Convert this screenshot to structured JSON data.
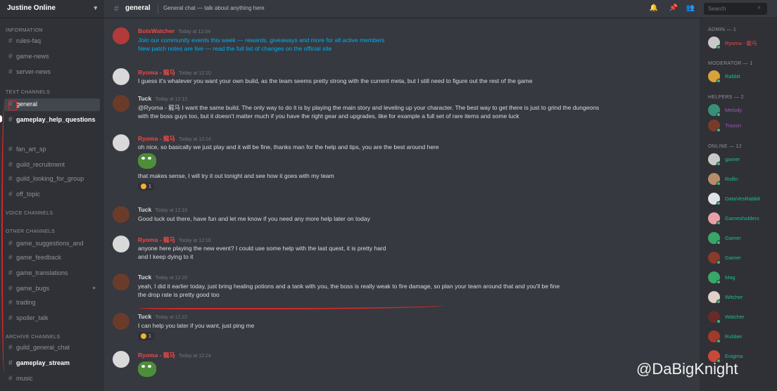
{
  "server": {
    "name": "Justine Online",
    "dropdown_icon": "chevron-down-icon"
  },
  "sidebar": {
    "categories": [
      "Information",
      "Text channels",
      "Voice channels",
      "Other channels",
      "Archive channels"
    ],
    "channels": [
      {
        "name": "rules-faq"
      },
      {
        "name": "game-news"
      },
      {
        "name": "server-news"
      },
      {
        "name": "general",
        "active": true
      },
      {
        "name": "gameplay_help_questions",
        "unread": true
      },
      {
        "name": "fan_art_sp"
      },
      {
        "name": "guild_recruitment"
      },
      {
        "name": "guild_looking_for_group"
      },
      {
        "name": "off_topic"
      },
      {
        "name": "game_suggestions_and"
      },
      {
        "name": "game_feedback"
      },
      {
        "name": "game_translations"
      },
      {
        "name": "game_bugs"
      },
      {
        "name": "trading"
      },
      {
        "name": "spoiler_talk"
      },
      {
        "name": "guild_general_chat"
      },
      {
        "name": "gameplay_stream",
        "unread": true
      },
      {
        "name": "music"
      }
    ],
    "add_label": "+"
  },
  "topbar": {
    "channel": "general",
    "topic": "General chat — talk about anything here",
    "search_placeholder": "Search",
    "icons": [
      "bell-icon",
      "pin-icon",
      "members-icon"
    ]
  },
  "chat": {
    "messages": [
      {
        "author": "BotsWatcher",
        "author_color": "#f04747",
        "timestamp": "Today at 12:04",
        "lines": [
          "Join our community events this week — rewards, giveaways and more for all active members",
          "New patch notes are live — read the full list of changes on the official site"
        ],
        "link": true
      },
      {
        "author": "Ryoma - 龍马",
        "author_color": "#f04747",
        "timestamp": "Today at 12:10",
        "lines": [
          "I guess it's whatever you want your own build, as the team seems pretty strong with the current meta, but I still need to figure out the rest of the game"
        ]
      },
      {
        "author": "Tuck",
        "author_color": "#dcddde",
        "timestamp": "Today at 12:12",
        "lines": [
          "@Ryoma - 龍马 I want the same build. The only way to do it is by playing the main story and leveling up your character. The best way to get there is just to grind the dungeons",
          "with the boss guys too, but it doesn't matter much if you have the right gear and upgrades, like for example a full set of rare items and some luck"
        ]
      },
      {
        "author": "Ryoma - 龍马",
        "author_color": "#f04747",
        "timestamp": "Today at 12:14",
        "lines": [
          "oh nice, so basically we just play and it will be fine, thanks man for the help and tips, you are the best around here"
        ],
        "sticker": true,
        "lines_after": [
          "that makes sense, I will try it out tonight and see how it goes with my team"
        ],
        "reaction": "1"
      },
      {
        "author": "Tuck",
        "author_color": "#dcddde",
        "timestamp": "Today at 12:16",
        "lines": [
          "Good luck out there, have fun and let me know if you need any more help later on today"
        ]
      },
      {
        "author": "Ryoma - 龍马",
        "author_color": "#f04747",
        "timestamp": "Today at 12:18",
        "lines": [
          "anyone here playing the new event? I could use some help with the last quest, it is pretty hard",
          "and I keep dying to it"
        ]
      },
      {
        "author": "Tuck",
        "author_color": "#dcddde",
        "timestamp": "Today at 12:20",
        "lines": [
          "yeah, I did it earlier today, just bring healing potions and a tank with you, the boss is really weak to fire damage, so plan your team around that and you'll be fine",
          "the drop rate is pretty good too"
        ]
      },
      {
        "author": "Tuck",
        "author_color": "#dcddde",
        "timestamp": "Today at 12:22",
        "lines": [
          "I can help you later if you want, just ping me"
        ],
        "reaction": "1"
      },
      {
        "author": "Ryoma - 龍马",
        "author_color": "#f04747",
        "timestamp": "Today at 12:24",
        "lines": [],
        "sticker": true
      }
    ]
  },
  "members": {
    "groups": [
      {
        "label": "Admin — 1",
        "names": [
          {
            "name": "Ryoma - 龍马",
            "color": "#f04747"
          }
        ]
      },
      {
        "label": "Moderator — 1",
        "names": [
          {
            "name": "Rabbit",
            "color": "#1abc9c"
          }
        ]
      },
      {
        "label": "Helpers — 2",
        "names": [
          {
            "name": "Melody",
            "color": "#9b59b6"
          },
          {
            "name": "Trazon",
            "color": "#9b59b6"
          }
        ]
      },
      {
        "label": "Online — 12",
        "names": [
          {
            "name": "gamer",
            "color": "#1abc9c"
          },
          {
            "name": "Rollin",
            "color": "#1abc9c"
          },
          {
            "name": "DataVesRabbit",
            "color": "#1abc9c"
          },
          {
            "name": "Gamesholders",
            "color": "#1abc9c"
          },
          {
            "name": "Gamer",
            "color": "#1abc9c"
          },
          {
            "name": "Gamer",
            "color": "#1abc9c"
          },
          {
            "name": "Mag",
            "color": "#1abc9c"
          },
          {
            "name": "Witcher",
            "color": "#1abc9c"
          },
          {
            "name": "Watcher",
            "color": "#1abc9c"
          },
          {
            "name": "Rubber",
            "color": "#1abc9c"
          },
          {
            "name": "Enigma",
            "color": "#1abc9c"
          }
        ]
      }
    ]
  },
  "watermark": "@DaBigKnight",
  "colors": {
    "bg": "#36393f",
    "sidebar": "#2f3136",
    "annotation": "#d62828",
    "link": "#00b0f4"
  }
}
